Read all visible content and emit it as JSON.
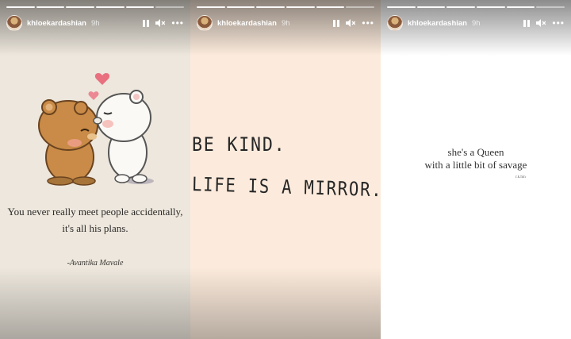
{
  "stories": [
    {
      "username": "khloekardashian",
      "time": "9h",
      "quote_line1": "You never really meet people accidentally,",
      "quote_line2": "it's all his plans.",
      "author": "-Avantika Mavale"
    },
    {
      "username": "khloekardashian",
      "time": "9h",
      "line1": "BE KIND.",
      "line2": "LIFE IS A MIRROR."
    },
    {
      "username": "khloekardashian",
      "time": "9h",
      "quote_line1": "she's a Queen",
      "quote_line2": "with a little bit of savage",
      "signature": "r.k.hin"
    }
  ],
  "icons": {
    "pause": "pause-icon",
    "mute": "mute-icon",
    "more": "more-options-icon",
    "heart": "heart-icon"
  },
  "more_glyph": "•••"
}
